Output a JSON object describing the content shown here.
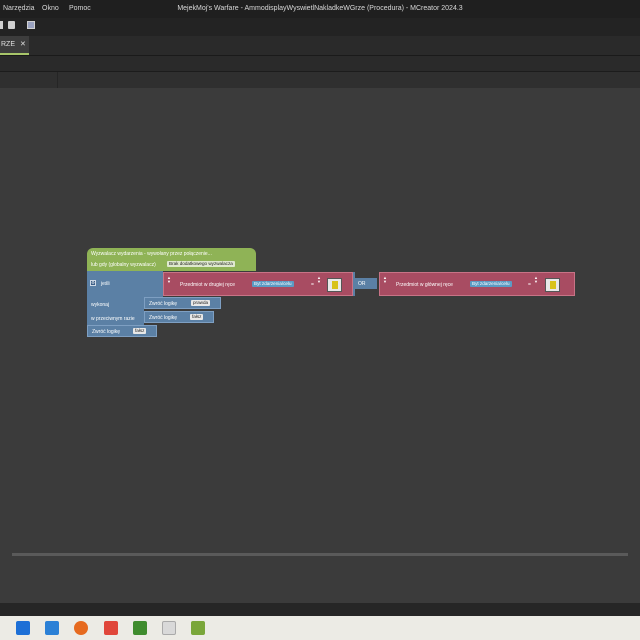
{
  "window": {
    "title": "MejekMoj's Warfare - AmmodisplayWyswietlNakladkeWGrze (Procedura) - MCreator 2024.3",
    "menu": [
      "Narzędzia",
      "Okno",
      "Pomoc"
    ]
  },
  "tabs": [
    {
      "label": "RZE",
      "close": "✕"
    }
  ],
  "blocks": {
    "event": {
      "line1": "Wyzwalacz wydarzenia - wywołany przez połączenie...",
      "line2": "lub gdy (globalny wyzwalacz)",
      "trigger": "Brak dodatkowego wyzwalacza"
    },
    "if_block": {
      "gear": "⚙",
      "if_label": "jeśli",
      "do_label": "wykonaj",
      "else_label": "w przeciwnym razie"
    },
    "condition_left": {
      "item": "Przedmiot w drugiej ręce",
      "entity": "Byt zdarzenia/celu",
      "op": "="
    },
    "or_label": "OR",
    "condition_right": {
      "item": "Przedmiot w głównej ręce",
      "entity": "Byt zdarzenia/celu",
      "op": "="
    },
    "return_do": {
      "label": "Zwróć logikę",
      "value": "prawda"
    },
    "return_else": {
      "label": "Zwróć logikę",
      "value": "fałsz"
    },
    "return_final": {
      "label": "Zwróć logikę",
      "value": "fałsz"
    }
  },
  "colors": {
    "event": "#8fb356",
    "if": "#5b80a5",
    "logic_or": "#5b80a5",
    "item_compare": "#a84c62",
    "entity": "#5b9bc4"
  },
  "taskbar": {
    "icons": [
      "windows-start-icon",
      "mail-icon",
      "firefox-icon",
      "app-icon",
      "minecraft-icon",
      "app2-icon",
      "mcreator-icon"
    ]
  }
}
